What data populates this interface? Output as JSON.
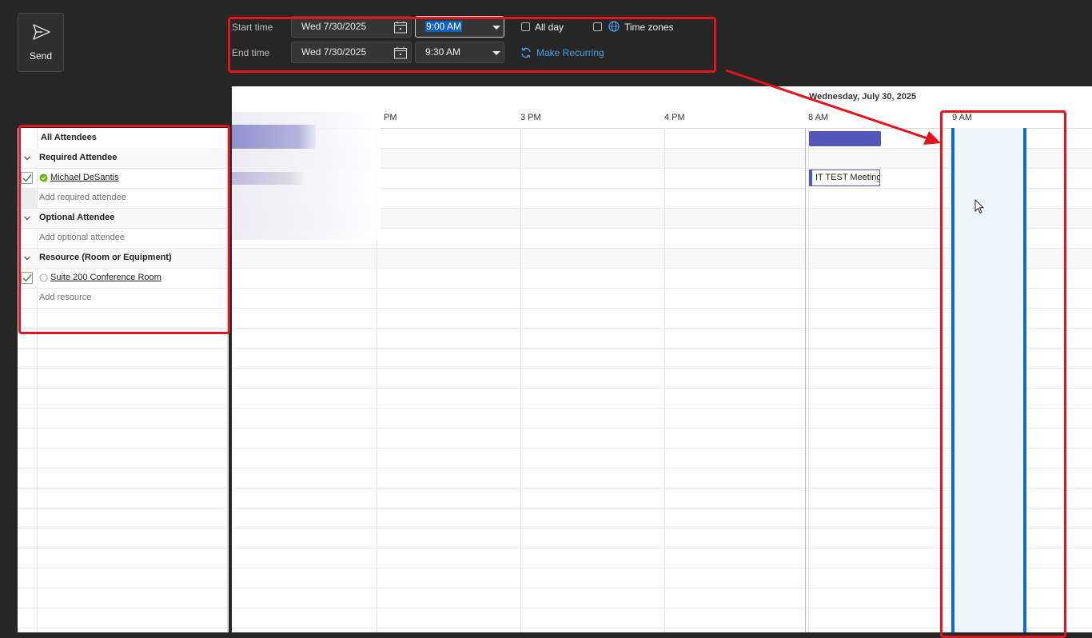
{
  "toolbar": {
    "send_label": "Send"
  },
  "time_fields": {
    "start_label": "Start time",
    "end_label": "End time",
    "start_date": "Wed 7/30/2025",
    "end_date": "Wed 7/30/2025",
    "start_time": "9:00 AM",
    "end_time": "9:30 AM",
    "all_day_label": "All day",
    "time_zones_label": "Time zones",
    "make_recurring_label": "Make Recurring",
    "all_day_checked": false,
    "time_zones_checked": false
  },
  "schedule": {
    "date_header": "Wednesday, July 30, 2025",
    "hours": [
      "PM",
      "3 PM",
      "4 PM",
      "8 AM",
      "9 AM"
    ],
    "event_title": "IT TEST Meeting"
  },
  "attendees": {
    "header": "All Attendees",
    "required_group": "Required Attendee",
    "required_name": "Michael DeSantis",
    "add_required": "Add required attendee",
    "optional_group": "Optional Attendee",
    "add_optional": "Add optional attendee",
    "resource_group": "Resource (Room or Equipment)",
    "resource_name": "Suite 200 Conference Room",
    "add_resource": "Add resource"
  },
  "colors": {
    "accent_red": "#e3141c",
    "selection_blue": "#0f6cc7",
    "busy_purple": "#5156b8",
    "link_blue": "#4aa3ef"
  }
}
